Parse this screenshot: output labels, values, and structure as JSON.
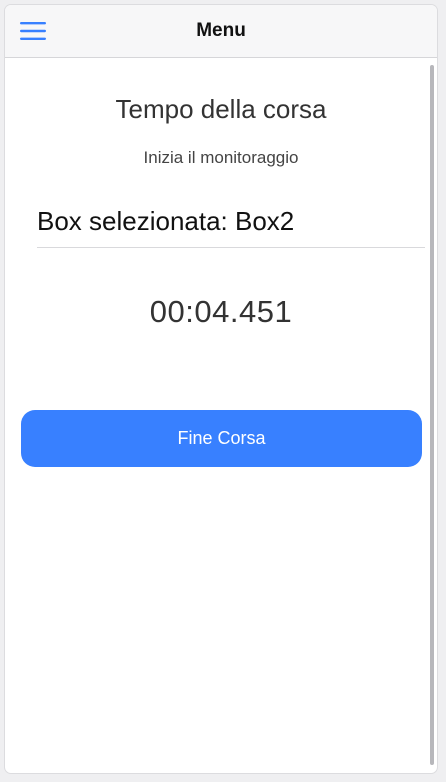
{
  "header": {
    "menu_icon": "hamburger-menu-icon",
    "title": "Menu"
  },
  "main": {
    "title": "Tempo della corsa",
    "subtitle": "Inizia il monitoraggio",
    "selected_box_label": "Box selezionata: Box2",
    "timer": "00:04.451",
    "end_button_label": "Fine Corsa"
  },
  "colors": {
    "accent": "#3880ff",
    "toolbar_bg": "#f7f7f8",
    "text_dark": "#333333"
  }
}
